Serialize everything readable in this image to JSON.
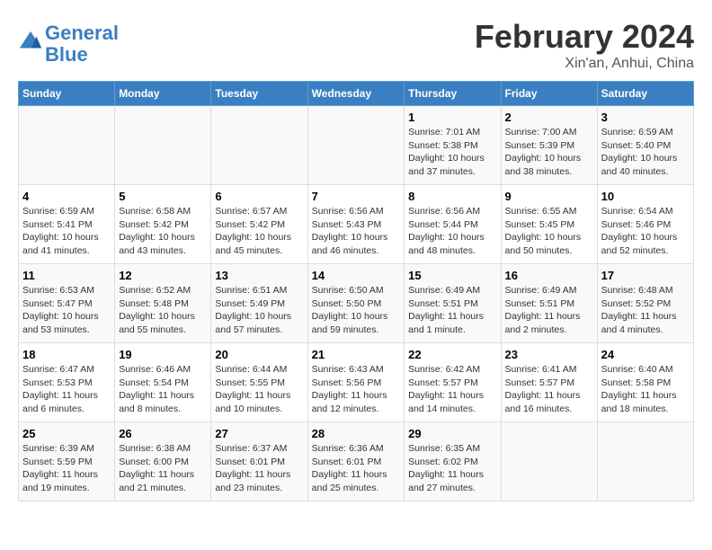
{
  "header": {
    "logo_line1": "General",
    "logo_line2": "Blue",
    "month_title": "February 2024",
    "location": "Xin'an, Anhui, China"
  },
  "weekdays": [
    "Sunday",
    "Monday",
    "Tuesday",
    "Wednesday",
    "Thursday",
    "Friday",
    "Saturday"
  ],
  "weeks": [
    [
      {
        "day": "",
        "info": ""
      },
      {
        "day": "",
        "info": ""
      },
      {
        "day": "",
        "info": ""
      },
      {
        "day": "",
        "info": ""
      },
      {
        "day": "1",
        "info": "Sunrise: 7:01 AM\nSunset: 5:38 PM\nDaylight: 10 hours\nand 37 minutes."
      },
      {
        "day": "2",
        "info": "Sunrise: 7:00 AM\nSunset: 5:39 PM\nDaylight: 10 hours\nand 38 minutes."
      },
      {
        "day": "3",
        "info": "Sunrise: 6:59 AM\nSunset: 5:40 PM\nDaylight: 10 hours\nand 40 minutes."
      }
    ],
    [
      {
        "day": "4",
        "info": "Sunrise: 6:59 AM\nSunset: 5:41 PM\nDaylight: 10 hours\nand 41 minutes."
      },
      {
        "day": "5",
        "info": "Sunrise: 6:58 AM\nSunset: 5:42 PM\nDaylight: 10 hours\nand 43 minutes."
      },
      {
        "day": "6",
        "info": "Sunrise: 6:57 AM\nSunset: 5:42 PM\nDaylight: 10 hours\nand 45 minutes."
      },
      {
        "day": "7",
        "info": "Sunrise: 6:56 AM\nSunset: 5:43 PM\nDaylight: 10 hours\nand 46 minutes."
      },
      {
        "day": "8",
        "info": "Sunrise: 6:56 AM\nSunset: 5:44 PM\nDaylight: 10 hours\nand 48 minutes."
      },
      {
        "day": "9",
        "info": "Sunrise: 6:55 AM\nSunset: 5:45 PM\nDaylight: 10 hours\nand 50 minutes."
      },
      {
        "day": "10",
        "info": "Sunrise: 6:54 AM\nSunset: 5:46 PM\nDaylight: 10 hours\nand 52 minutes."
      }
    ],
    [
      {
        "day": "11",
        "info": "Sunrise: 6:53 AM\nSunset: 5:47 PM\nDaylight: 10 hours\nand 53 minutes."
      },
      {
        "day": "12",
        "info": "Sunrise: 6:52 AM\nSunset: 5:48 PM\nDaylight: 10 hours\nand 55 minutes."
      },
      {
        "day": "13",
        "info": "Sunrise: 6:51 AM\nSunset: 5:49 PM\nDaylight: 10 hours\nand 57 minutes."
      },
      {
        "day": "14",
        "info": "Sunrise: 6:50 AM\nSunset: 5:50 PM\nDaylight: 10 hours\nand 59 minutes."
      },
      {
        "day": "15",
        "info": "Sunrise: 6:49 AM\nSunset: 5:51 PM\nDaylight: 11 hours\nand 1 minute."
      },
      {
        "day": "16",
        "info": "Sunrise: 6:49 AM\nSunset: 5:51 PM\nDaylight: 11 hours\nand 2 minutes."
      },
      {
        "day": "17",
        "info": "Sunrise: 6:48 AM\nSunset: 5:52 PM\nDaylight: 11 hours\nand 4 minutes."
      }
    ],
    [
      {
        "day": "18",
        "info": "Sunrise: 6:47 AM\nSunset: 5:53 PM\nDaylight: 11 hours\nand 6 minutes."
      },
      {
        "day": "19",
        "info": "Sunrise: 6:46 AM\nSunset: 5:54 PM\nDaylight: 11 hours\nand 8 minutes."
      },
      {
        "day": "20",
        "info": "Sunrise: 6:44 AM\nSunset: 5:55 PM\nDaylight: 11 hours\nand 10 minutes."
      },
      {
        "day": "21",
        "info": "Sunrise: 6:43 AM\nSunset: 5:56 PM\nDaylight: 11 hours\nand 12 minutes."
      },
      {
        "day": "22",
        "info": "Sunrise: 6:42 AM\nSunset: 5:57 PM\nDaylight: 11 hours\nand 14 minutes."
      },
      {
        "day": "23",
        "info": "Sunrise: 6:41 AM\nSunset: 5:57 PM\nDaylight: 11 hours\nand 16 minutes."
      },
      {
        "day": "24",
        "info": "Sunrise: 6:40 AM\nSunset: 5:58 PM\nDaylight: 11 hours\nand 18 minutes."
      }
    ],
    [
      {
        "day": "25",
        "info": "Sunrise: 6:39 AM\nSunset: 5:59 PM\nDaylight: 11 hours\nand 19 minutes."
      },
      {
        "day": "26",
        "info": "Sunrise: 6:38 AM\nSunset: 6:00 PM\nDaylight: 11 hours\nand 21 minutes."
      },
      {
        "day": "27",
        "info": "Sunrise: 6:37 AM\nSunset: 6:01 PM\nDaylight: 11 hours\nand 23 minutes."
      },
      {
        "day": "28",
        "info": "Sunrise: 6:36 AM\nSunset: 6:01 PM\nDaylight: 11 hours\nand 25 minutes."
      },
      {
        "day": "29",
        "info": "Sunrise: 6:35 AM\nSunset: 6:02 PM\nDaylight: 11 hours\nand 27 minutes."
      },
      {
        "day": "",
        "info": ""
      },
      {
        "day": "",
        "info": ""
      }
    ]
  ]
}
